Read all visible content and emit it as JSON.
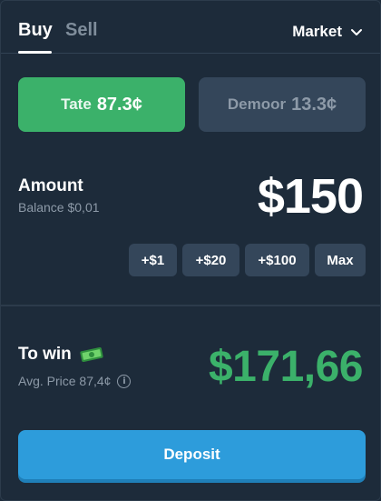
{
  "tabs": {
    "buy": "Buy",
    "sell": "Sell"
  },
  "order_type": {
    "label": "Market"
  },
  "outcomes": [
    {
      "name": "Tate",
      "price": "87.3¢"
    },
    {
      "name": "Demoor",
      "price": "13.3¢"
    }
  ],
  "amount": {
    "label": "Amount",
    "balance": "Balance $0,01",
    "value": "$150"
  },
  "quick_add": [
    "+$1",
    "+$20",
    "+$100",
    "Max"
  ],
  "to_win": {
    "label": "To win",
    "avg_price": "Avg. Price 87,4¢",
    "value": "$171,66"
  },
  "deposit": {
    "label": "Deposit"
  },
  "colors": {
    "background": "#1d2b3a",
    "green": "#3bb16a",
    "blue": "#2d9cdb",
    "muted": "#8d9aa8",
    "button": "#34465a"
  }
}
